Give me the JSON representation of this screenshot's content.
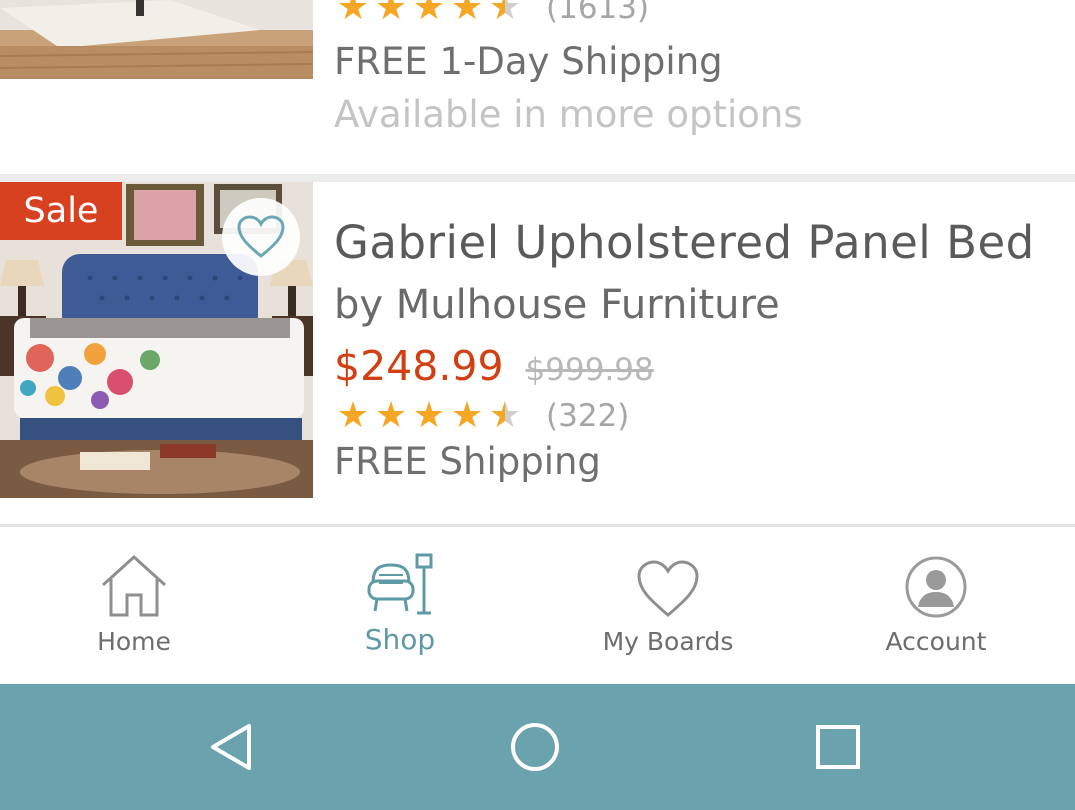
{
  "products": [
    {
      "rating": 4.5,
      "review_count": "(1613)",
      "shipping": "FREE 1-Day Shipping",
      "more_options": "Available in more options"
    },
    {
      "badge": "Sale",
      "title": "Gabriel Upholstered Panel Bed",
      "brand": "by Mulhouse Furniture",
      "price": "$248.99",
      "original_price": "$999.98",
      "rating": 4.5,
      "review_count": "(322)",
      "shipping_partial": "FREE Shipping"
    }
  ],
  "tabbar": {
    "tabs": [
      {
        "label": "Home",
        "icon": "home-icon",
        "active": false
      },
      {
        "label": "Shop",
        "icon": "shop-icon",
        "active": true
      },
      {
        "label": "My Boards",
        "icon": "heart-icon",
        "active": false
      },
      {
        "label": "Account",
        "icon": "account-icon",
        "active": false
      }
    ]
  },
  "system_nav": {
    "buttons": [
      "back-icon",
      "home-circle-icon",
      "recents-icon"
    ]
  },
  "colors": {
    "sale_red": "#d7411f",
    "price_red": "#d13f13",
    "accent_teal": "#5d9aa6",
    "navbar_teal": "#6aa2ad",
    "star_gold": "#f5a623"
  }
}
